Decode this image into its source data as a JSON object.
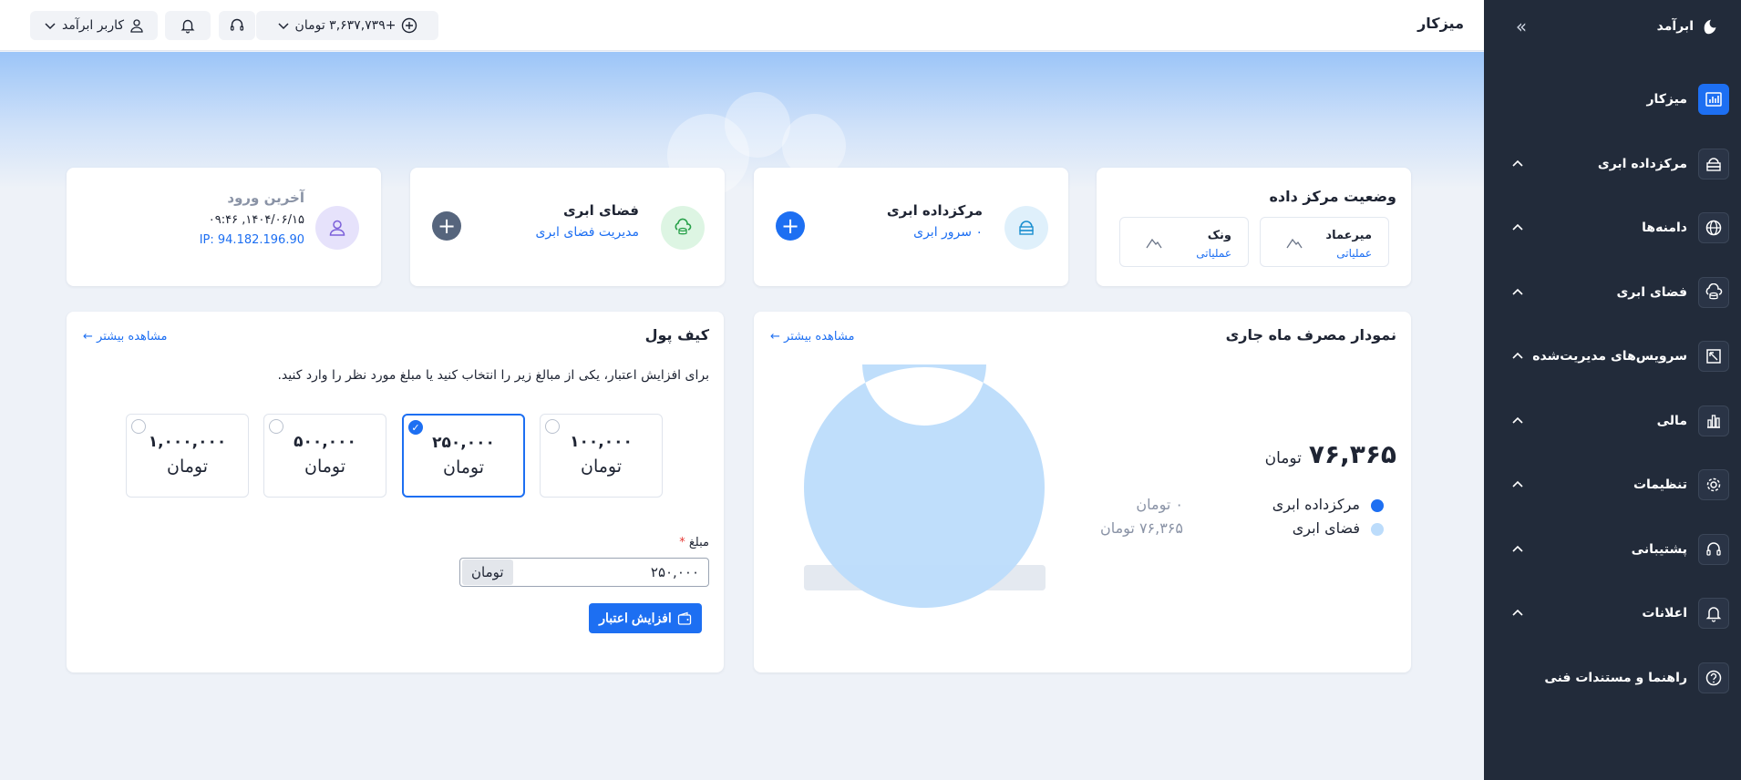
{
  "brand": {
    "name": "ابرآمد"
  },
  "sidebar": {
    "items": [
      {
        "label": "میزکار",
        "icon": "chart-icon"
      },
      {
        "label": "مرکزداده ابری",
        "icon": "server-cloud-icon"
      },
      {
        "label": "دامنه‌ها",
        "icon": "globe-icon"
      },
      {
        "label": "فضای ابری",
        "icon": "cloud-storage-icon"
      },
      {
        "label": "سرویس‌های مدیریت‌شده",
        "icon": "resize-icon"
      },
      {
        "label": "مالی",
        "icon": "bar-chart-icon"
      },
      {
        "label": "تنظیمات",
        "icon": "gear-icon"
      },
      {
        "label": "پشتیبانی",
        "icon": "headset-icon"
      },
      {
        "label": "اعلانات",
        "icon": "bell-icon"
      },
      {
        "label": "راهنما و مستندات فنی",
        "icon": "help-icon"
      }
    ]
  },
  "header": {
    "title": "میزکار",
    "user_label": "کاربر ابرآمد",
    "balance_label": "+۳,۶۳۷,۷۳۹ تومان"
  },
  "dc_status": {
    "title": "وضعیت مرکز داده",
    "locations": [
      {
        "name": "میرعماد",
        "status": "عملیاتی"
      },
      {
        "name": "ونک",
        "status": "عملیاتی"
      }
    ]
  },
  "cloud_dc": {
    "title": "مرکزداده ابری",
    "subtitle": "۰ سرور ابری"
  },
  "cloud_space": {
    "title": "فضای ابری",
    "subtitle": "مدیریت فضای ابری"
  },
  "last_login": {
    "title": "آخرین ورود",
    "time": "۱۴۰۴/۰۶/۱۵, ۰۹:۴۶",
    "ip": "IP: 94.182.196.90"
  },
  "usage": {
    "title": "نمودار مصرف ماه جاری",
    "more": "مشاهده بیشتر",
    "total": "۷۶,۳۶۵",
    "unit": "تومان"
  },
  "chart_data": {
    "type": "pie",
    "categories": [
      "مرکزداده ابری",
      "فضای ابری"
    ],
    "values": [
      0,
      76365
    ],
    "value_labels": [
      "۰ تومان",
      "۷۶,۳۶۵ تومان"
    ],
    "colors": [
      "#1d6ff2",
      "#bcdcfb"
    ]
  },
  "wallet": {
    "title": "کیف پول",
    "more": "مشاهده بیشتر",
    "description": "برای افزایش اعتبار، یکی از مبالغ زیر را انتخاب کنید یا مبلغ مورد نظر را وارد کنید.",
    "options": [
      {
        "value": "۱۰۰,۰۰۰",
        "unit": "تومان"
      },
      {
        "value": "۲۵۰,۰۰۰",
        "unit": "تومان"
      },
      {
        "value": "۵۰۰,۰۰۰",
        "unit": "تومان"
      },
      {
        "value": "۱,۰۰۰,۰۰۰",
        "unit": "تومان"
      }
    ],
    "selected_option": "۲۵۰,۰۰۰",
    "amount_label": "مبلغ",
    "required_mark": "*",
    "amount_value": "۲۵۰,۰۰۰",
    "amount_unit": "تومان",
    "charge_button": "افزایش اعتبار"
  },
  "colors": {
    "primary": "#1d6ff2",
    "sidebar": "#222b3a",
    "accent_purple": "#e6e2fb"
  }
}
